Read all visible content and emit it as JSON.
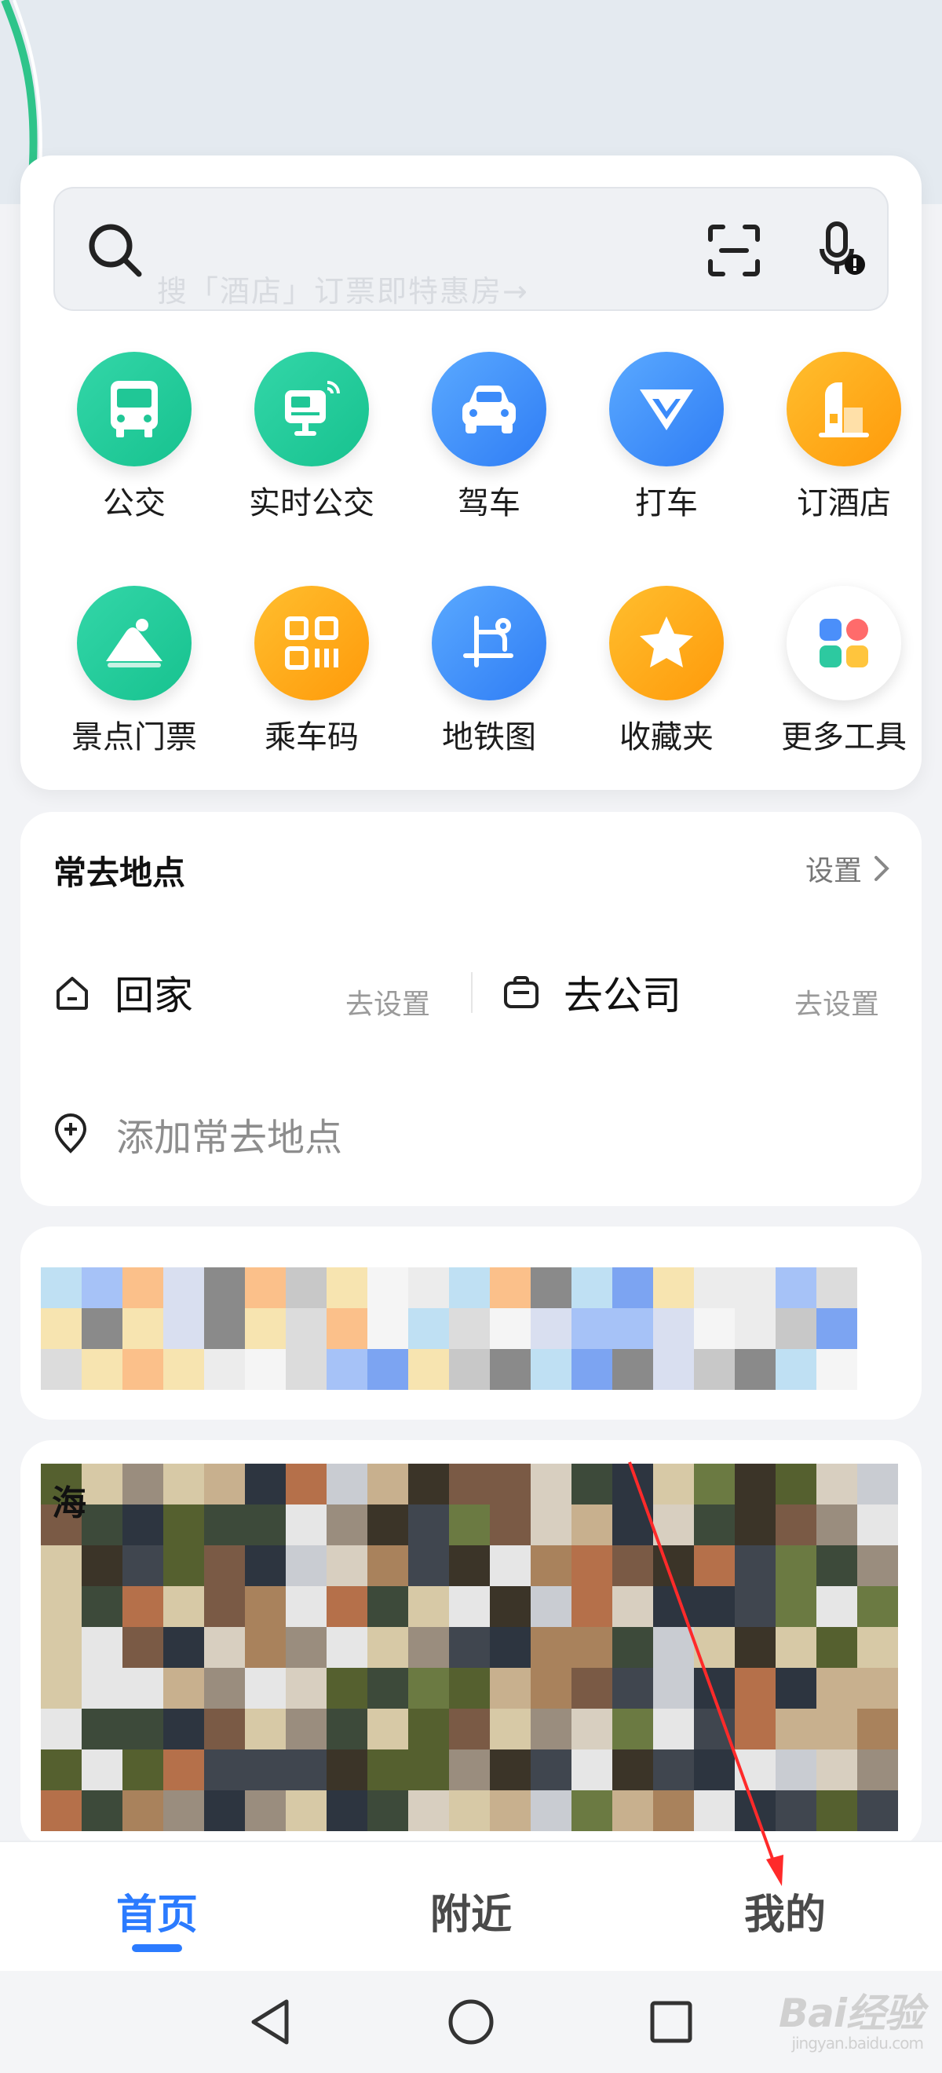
{
  "search": {
    "placeholder": "搜「酒店」订票即特惠房→"
  },
  "tools_row1": [
    {
      "label": "公交"
    },
    {
      "label": "实时公交"
    },
    {
      "label": "驾车"
    },
    {
      "label": "打车"
    },
    {
      "label": "订酒店"
    }
  ],
  "tools_row2": [
    {
      "label": "景点门票"
    },
    {
      "label": "乘车码"
    },
    {
      "label": "地铁图"
    },
    {
      "label": "收藏夹"
    },
    {
      "label": "更多工具"
    }
  ],
  "places": {
    "title": "常去地点",
    "settings_label": "设置",
    "home_label": "回家",
    "home_action": "去设置",
    "work_label": "去公司",
    "work_action": "去设置",
    "add_label": "添加常去地点"
  },
  "feed": {
    "card2_title_fragment": "海"
  },
  "bottom_nav": {
    "home": "首页",
    "nearby": "附近",
    "mine": "我的"
  },
  "watermark": {
    "brand": "Bai经验",
    "url": "jingyan.baidu.com"
  },
  "colors": {
    "accent": "#2b7bff",
    "green": "#1fc99a",
    "blue": "#3b8bfa",
    "orange": "#ffa514"
  }
}
